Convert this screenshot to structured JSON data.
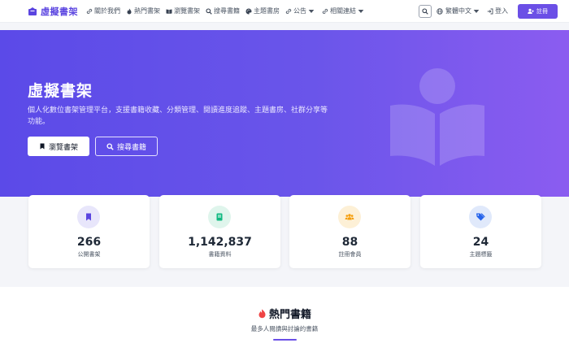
{
  "brand": {
    "name": "虛擬書架"
  },
  "nav": {
    "items": [
      {
        "label": "關於我們",
        "icon": "link-icon"
      },
      {
        "label": "熱門書架",
        "icon": "fire-icon"
      },
      {
        "label": "瀏覽書架",
        "icon": "book-open-icon"
      },
      {
        "label": "搜尋書籍",
        "icon": "search-icon"
      },
      {
        "label": "主題書房",
        "icon": "palette-icon"
      },
      {
        "label": "公告",
        "icon": "link-icon",
        "dropdown": true
      },
      {
        "label": "相關連結",
        "icon": "link-icon",
        "dropdown": true
      }
    ],
    "language": "繁體中文",
    "login": "登入",
    "register": "註冊"
  },
  "hero": {
    "title": "虛擬書架",
    "description": "個人化數位書架管理平台，支援書籍收藏、分類管理、閱讀進度追蹤、主題書房、社群分享等功能。",
    "browse_button": "瀏覽書架",
    "search_button": "搜尋書籍"
  },
  "stats": [
    {
      "value": "266",
      "label": "公開書架",
      "icon": "bookmark-icon",
      "color": "#5b45e0",
      "bg": "#e8e6fb"
    },
    {
      "value": "1,142,837",
      "label": "書籍資料",
      "icon": "book-icon",
      "color": "#10b981",
      "bg": "#dff5ec"
    },
    {
      "value": "88",
      "label": "註冊會員",
      "icon": "users-icon",
      "color": "#f59e0b",
      "bg": "#fdf0d6"
    },
    {
      "value": "24",
      "label": "主題標籤",
      "icon": "tags-icon",
      "color": "#2563eb",
      "bg": "#e0e9fb"
    }
  ],
  "popular": {
    "title": "熱門書籍",
    "subtitle": "最多人閱讀與討論的書籍",
    "accent": "#6b4fe6"
  }
}
